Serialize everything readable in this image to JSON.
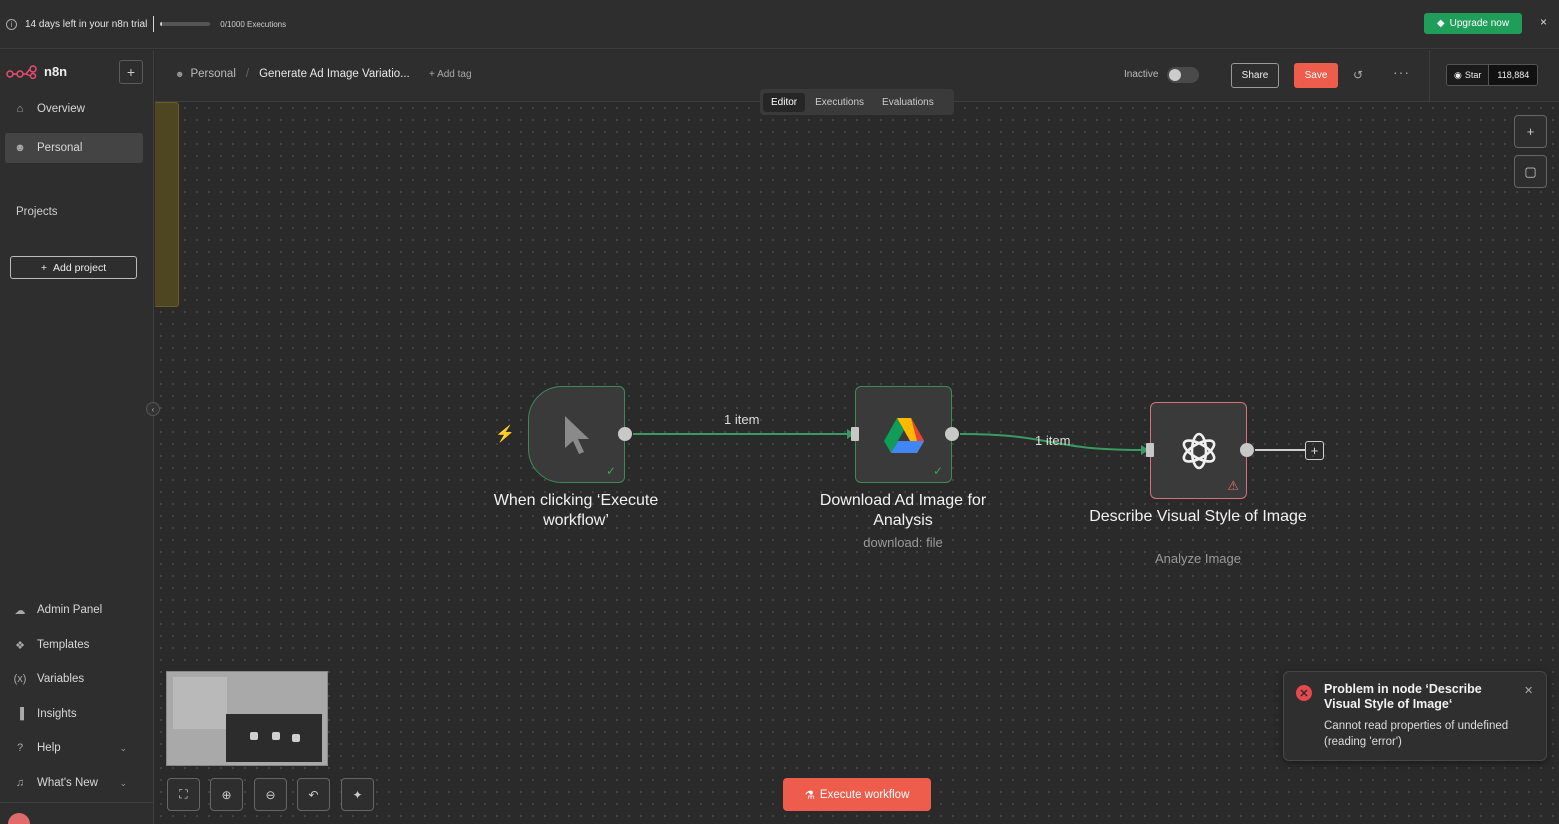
{
  "trial": {
    "days_left": "14 days left in your n8n trial",
    "executions": "0/1000 Executions",
    "executions_progress_fraction": 0.0,
    "upgrade_label": "Upgrade now",
    "close": "×"
  },
  "sidebar": {
    "logo_text": "n8n",
    "new_button": "+",
    "top_items": [
      {
        "label": "Overview",
        "icon": "home-icon"
      },
      {
        "label": "Personal",
        "icon": "user-icon",
        "active": true
      }
    ],
    "projects_label": "Projects",
    "add_project_label": "Add project",
    "bottom_items": [
      {
        "label": "Admin Panel",
        "icon": "cloud-icon"
      },
      {
        "label": "Templates",
        "icon": "box-icon"
      },
      {
        "label": "Variables",
        "icon": "variable-icon"
      },
      {
        "label": "Insights",
        "icon": "chart-icon"
      },
      {
        "label": "Help",
        "icon": "help-icon",
        "chevron": true
      },
      {
        "label": "What's New",
        "icon": "bell-icon",
        "chevron": true
      }
    ]
  },
  "header": {
    "breadcrumb_project": "Personal",
    "separator": "/",
    "workflow_name": "Generate Ad Image Variatio...",
    "add_tag": "+ Add tag",
    "status_label": "Inactive",
    "share_label": "Share",
    "save_label": "Save",
    "github_star": "Star",
    "github_count": "118,884"
  },
  "tabs": [
    "Editor",
    "Executions",
    "Evaluations"
  ],
  "active_tab": "Editor",
  "workflow": {
    "nodes": [
      {
        "title": "When clicking ‘Execute workflow’",
        "subtitle": "",
        "icon": "cursor-icon",
        "status": "success"
      },
      {
        "title": "Download Ad Image for Analysis",
        "subtitle": "download: file",
        "icon": "google-drive-icon",
        "status": "success"
      },
      {
        "title": "Describe Visual Style of Image",
        "subtitle": "Analyze Image",
        "icon": "openai-icon",
        "status": "error"
      }
    ],
    "edges": [
      {
        "from": "When clicking ‘Execute workflow’",
        "to": "Download Ad Image for Analysis",
        "label": "1 item"
      },
      {
        "from": "Download Ad Image for Analysis",
        "to": "Describe Visual Style of Image",
        "label": "1 item"
      }
    ]
  },
  "execute_label": "Execute workflow",
  "toast": {
    "title": "Problem in node ‘Describe Visual Style of Image‘",
    "message": "Cannot read properties of undefined (reading 'error')"
  },
  "colors": {
    "accent": "#ee5d4c",
    "success": "#1f9e5a",
    "edge": "#3a9a63",
    "error": "#e5484d"
  }
}
